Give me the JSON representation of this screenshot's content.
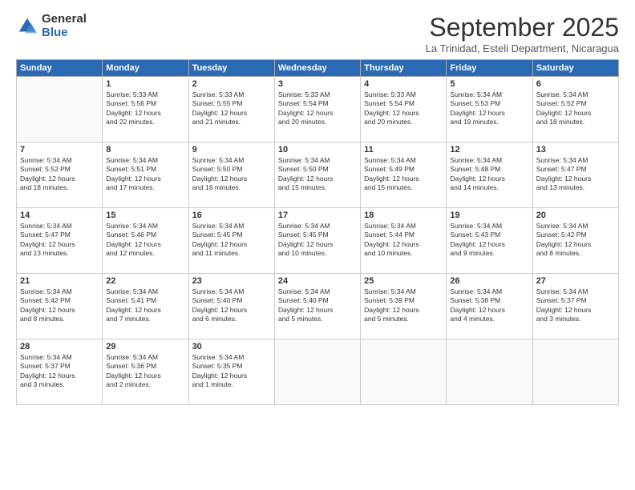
{
  "logo": {
    "general": "General",
    "blue": "Blue"
  },
  "title": "September 2025",
  "subtitle": "La Trinidad, Esteli Department, Nicaragua",
  "headers": [
    "Sunday",
    "Monday",
    "Tuesday",
    "Wednesday",
    "Thursday",
    "Friday",
    "Saturday"
  ],
  "weeks": [
    [
      {
        "day": "",
        "text": ""
      },
      {
        "day": "1",
        "text": "Sunrise: 5:33 AM\nSunset: 5:56 PM\nDaylight: 12 hours\nand 22 minutes."
      },
      {
        "day": "2",
        "text": "Sunrise: 5:33 AM\nSunset: 5:55 PM\nDaylight: 12 hours\nand 21 minutes."
      },
      {
        "day": "3",
        "text": "Sunrise: 5:33 AM\nSunset: 5:54 PM\nDaylight: 12 hours\nand 20 minutes."
      },
      {
        "day": "4",
        "text": "Sunrise: 5:33 AM\nSunset: 5:54 PM\nDaylight: 12 hours\nand 20 minutes."
      },
      {
        "day": "5",
        "text": "Sunrise: 5:34 AM\nSunset: 5:53 PM\nDaylight: 12 hours\nand 19 minutes."
      },
      {
        "day": "6",
        "text": "Sunrise: 5:34 AM\nSunset: 5:52 PM\nDaylight: 12 hours\nand 18 minutes."
      }
    ],
    [
      {
        "day": "7",
        "text": "Sunrise: 5:34 AM\nSunset: 5:52 PM\nDaylight: 12 hours\nand 18 minutes."
      },
      {
        "day": "8",
        "text": "Sunrise: 5:34 AM\nSunset: 5:51 PM\nDaylight: 12 hours\nand 17 minutes."
      },
      {
        "day": "9",
        "text": "Sunrise: 5:34 AM\nSunset: 5:50 PM\nDaylight: 12 hours\nand 16 minutes."
      },
      {
        "day": "10",
        "text": "Sunrise: 5:34 AM\nSunset: 5:50 PM\nDaylight: 12 hours\nand 15 minutes."
      },
      {
        "day": "11",
        "text": "Sunrise: 5:34 AM\nSunset: 5:49 PM\nDaylight: 12 hours\nand 15 minutes."
      },
      {
        "day": "12",
        "text": "Sunrise: 5:34 AM\nSunset: 5:48 PM\nDaylight: 12 hours\nand 14 minutes."
      },
      {
        "day": "13",
        "text": "Sunrise: 5:34 AM\nSunset: 5:47 PM\nDaylight: 12 hours\nand 13 minutes."
      }
    ],
    [
      {
        "day": "14",
        "text": "Sunrise: 5:34 AM\nSunset: 5:47 PM\nDaylight: 12 hours\nand 13 minutes."
      },
      {
        "day": "15",
        "text": "Sunrise: 5:34 AM\nSunset: 5:46 PM\nDaylight: 12 hours\nand 12 minutes."
      },
      {
        "day": "16",
        "text": "Sunrise: 5:34 AM\nSunset: 5:45 PM\nDaylight: 12 hours\nand 11 minutes."
      },
      {
        "day": "17",
        "text": "Sunrise: 5:34 AM\nSunset: 5:45 PM\nDaylight: 12 hours\nand 10 minutes."
      },
      {
        "day": "18",
        "text": "Sunrise: 5:34 AM\nSunset: 5:44 PM\nDaylight: 12 hours\nand 10 minutes."
      },
      {
        "day": "19",
        "text": "Sunrise: 5:34 AM\nSunset: 5:43 PM\nDaylight: 12 hours\nand 9 minutes."
      },
      {
        "day": "20",
        "text": "Sunrise: 5:34 AM\nSunset: 5:42 PM\nDaylight: 12 hours\nand 8 minutes."
      }
    ],
    [
      {
        "day": "21",
        "text": "Sunrise: 5:34 AM\nSunset: 5:42 PM\nDaylight: 12 hours\nand 8 minutes."
      },
      {
        "day": "22",
        "text": "Sunrise: 5:34 AM\nSunset: 5:41 PM\nDaylight: 12 hours\nand 7 minutes."
      },
      {
        "day": "23",
        "text": "Sunrise: 5:34 AM\nSunset: 5:40 PM\nDaylight: 12 hours\nand 6 minutes."
      },
      {
        "day": "24",
        "text": "Sunrise: 5:34 AM\nSunset: 5:40 PM\nDaylight: 12 hours\nand 5 minutes."
      },
      {
        "day": "25",
        "text": "Sunrise: 5:34 AM\nSunset: 5:39 PM\nDaylight: 12 hours\nand 5 minutes."
      },
      {
        "day": "26",
        "text": "Sunrise: 5:34 AM\nSunset: 5:38 PM\nDaylight: 12 hours\nand 4 minutes."
      },
      {
        "day": "27",
        "text": "Sunrise: 5:34 AM\nSunset: 5:37 PM\nDaylight: 12 hours\nand 3 minutes."
      }
    ],
    [
      {
        "day": "28",
        "text": "Sunrise: 5:34 AM\nSunset: 5:37 PM\nDaylight: 12 hours\nand 3 minutes."
      },
      {
        "day": "29",
        "text": "Sunrise: 5:34 AM\nSunset: 5:36 PM\nDaylight: 12 hours\nand 2 minutes."
      },
      {
        "day": "30",
        "text": "Sunrise: 5:34 AM\nSunset: 5:35 PM\nDaylight: 12 hours\nand 1 minute."
      },
      {
        "day": "",
        "text": ""
      },
      {
        "day": "",
        "text": ""
      },
      {
        "day": "",
        "text": ""
      },
      {
        "day": "",
        "text": ""
      }
    ]
  ]
}
